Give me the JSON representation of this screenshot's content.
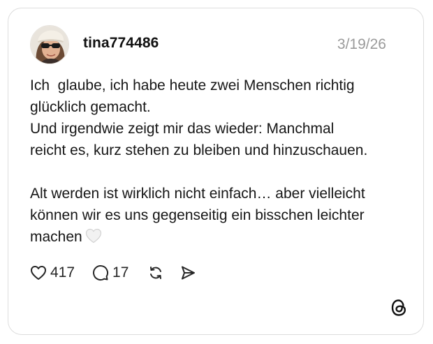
{
  "post": {
    "username": "tina774486",
    "date": "3/19/26",
    "text_lines": [
      "Ich  glaube, ich habe heute zwei Menschen richtig",
      "glücklich gemacht.",
      "Und irgendwie zeigt mir das wieder: Manchmal",
      "reicht es, kurz stehen zu bleiben und hinzuschauen.",
      "",
      "Alt werden ist wirklich nicht einfach… aber vielleicht",
      "können wir es uns gegenseitig ein bisschen leichter",
      "machen"
    ],
    "trailing_emoji": "white-heart-emoji"
  },
  "actions": {
    "likes": "417",
    "replies": "17",
    "like_icon": "heart-outline-icon",
    "reply_icon": "speech-bubble-icon",
    "repost_icon": "repost-arrows-icon",
    "share_icon": "send-arrow-icon"
  },
  "branding": {
    "logo_icon": "threads-logo-icon"
  },
  "colors": {
    "text": "#161616",
    "muted": "#9a9a9a",
    "border": "#dddddd",
    "background": "#ffffff"
  }
}
